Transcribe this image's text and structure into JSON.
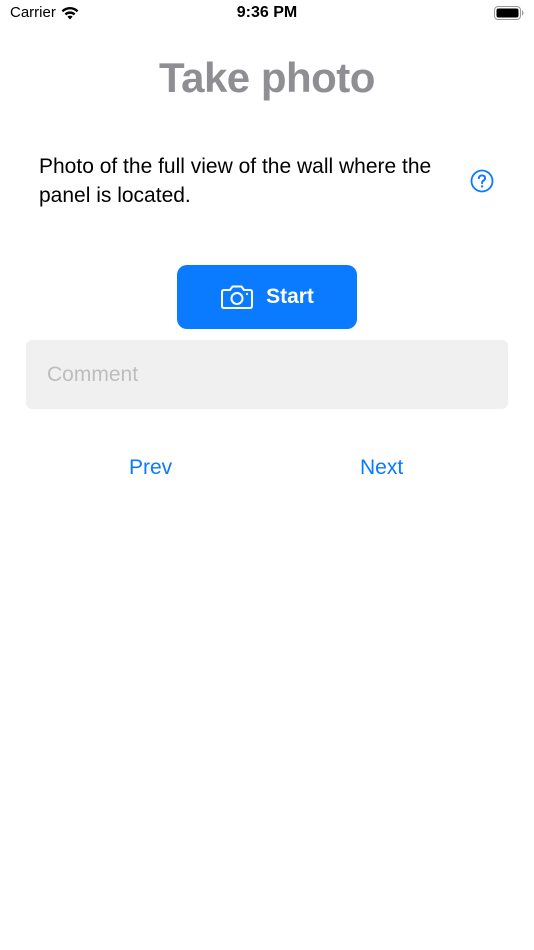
{
  "status_bar": {
    "carrier": "Carrier",
    "time": "9:36 PM",
    "icons": [
      "wifi-icon",
      "battery-icon"
    ]
  },
  "title": "Take photo",
  "instruction": {
    "text": "Photo of the full view of the wall where the panel is located.",
    "help_icon": "question-circle-icon"
  },
  "start_button": {
    "label": "Start",
    "icon": "camera-icon"
  },
  "comment": {
    "value": "",
    "placeholder": "Comment"
  },
  "navigation": {
    "prev_label": "Prev",
    "next_label": "Next"
  },
  "colors": {
    "accent": "#0a7aff",
    "title": "#8e8e93",
    "field_background": "#f0f0f0",
    "placeholder": "#bdbdbd"
  }
}
